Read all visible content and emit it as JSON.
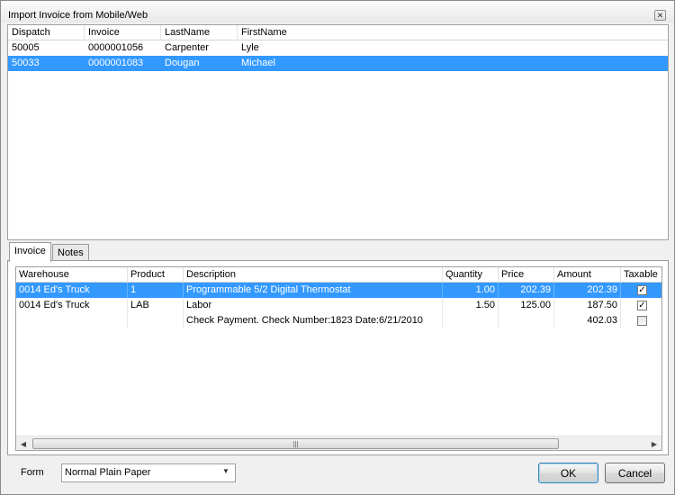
{
  "window": {
    "title": "Import Invoice from Mobile/Web"
  },
  "dispatch_list": {
    "columns": [
      "Dispatch",
      "Invoice",
      "LastName",
      "FirstName"
    ],
    "rows": [
      {
        "dispatch": "50005",
        "invoice": "0000001056",
        "last_name": "Carpenter",
        "first_name": "Lyle",
        "selected": false
      },
      {
        "dispatch": "50033",
        "invoice": "0000001083",
        "last_name": "Dougan",
        "first_name": "Michael",
        "selected": true
      }
    ]
  },
  "tabs": [
    {
      "label": "Invoice",
      "active": true
    },
    {
      "label": "Notes",
      "active": false
    }
  ],
  "invoice_grid": {
    "columns": [
      "Warehouse",
      "Product",
      "Description",
      "Quantity",
      "Price",
      "Amount",
      "Taxable"
    ],
    "rows": [
      {
        "warehouse": "0014 Ed's Truck",
        "product": "1",
        "description": "Programmable 5/2 Digital Thermostat",
        "quantity": "1.00",
        "price": "202.39",
        "amount": "202.39",
        "taxable": true,
        "selected": true
      },
      {
        "warehouse": "0014 Ed's Truck",
        "product": "LAB",
        "description": "Labor",
        "quantity": "1.50",
        "price": "125.00",
        "amount": "187.50",
        "taxable": true,
        "selected": false
      },
      {
        "warehouse": "",
        "product": "",
        "description": "Check Payment. Check Number:1823 Date:6/21/2010",
        "quantity": "",
        "price": "",
        "amount": "402.03",
        "taxable": false,
        "selected": false
      }
    ]
  },
  "footer": {
    "form_label": "Form",
    "form_value": "Normal Plain Paper",
    "ok_label": "OK",
    "cancel_label": "Cancel"
  },
  "colors": {
    "selection": "#3399ff"
  }
}
